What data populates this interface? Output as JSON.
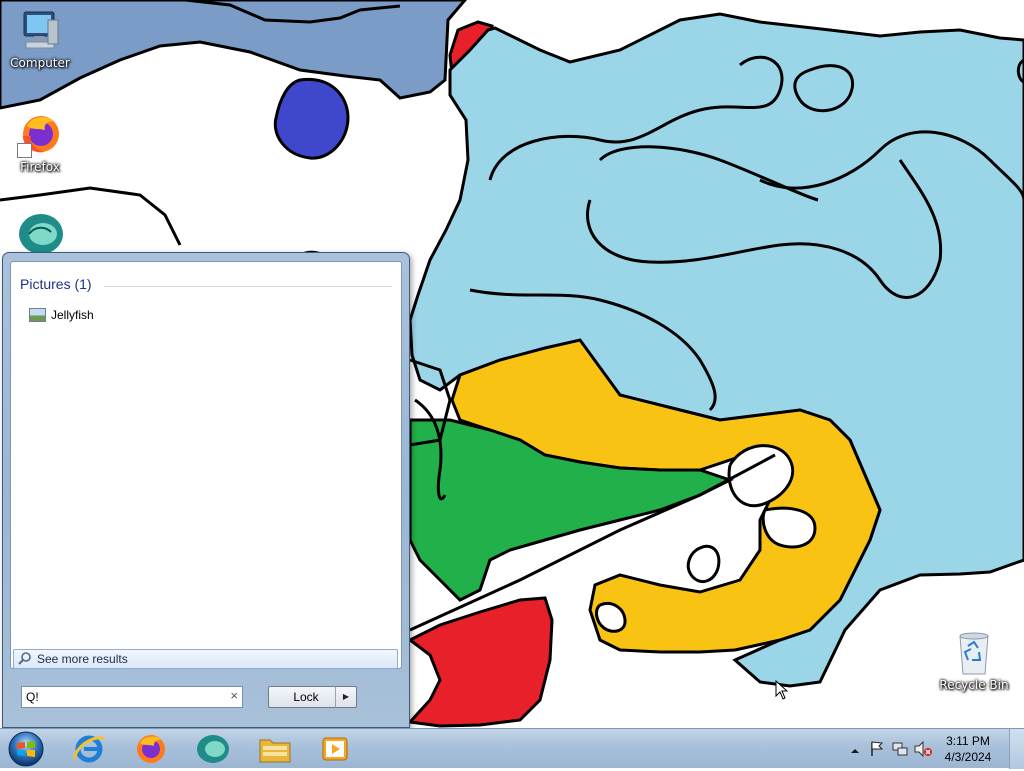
{
  "desktop": {
    "icons": [
      {
        "name": "computer",
        "label": "Computer"
      },
      {
        "name": "firefox",
        "label": "Firefox"
      },
      {
        "name": "recycle-bin",
        "label": "Recycle Bin"
      }
    ]
  },
  "start_menu": {
    "group_header": "Pictures (1)",
    "results": [
      {
        "label": "Jellyfish",
        "icon": "picture-icon"
      }
    ],
    "see_more_label": "See more results",
    "search_value": "Q!",
    "search_clear": "×",
    "power_button_label": "Lock",
    "power_arrow": "▶"
  },
  "taskbar": {
    "pinned": [
      {
        "name": "internet-explorer",
        "icon": "internet-explorer-icon"
      },
      {
        "name": "firefox",
        "icon": "firefox-icon"
      },
      {
        "name": "app-green",
        "icon": "green-app-icon"
      },
      {
        "name": "windows-explorer",
        "icon": "folder-icon"
      },
      {
        "name": "media-player",
        "icon": "media-player-icon"
      }
    ],
    "tray": {
      "time": "3:11 PM",
      "date": "4/3/2024",
      "icons": [
        "show-hidden-icons-icon",
        "action-center-flag-icon",
        "network-icon",
        "volume-muted-icon"
      ]
    }
  },
  "colors": {
    "start_menu_frame": "#a9c2dc",
    "results_header": "#1e3287",
    "taskbar": "#a8c0da"
  }
}
